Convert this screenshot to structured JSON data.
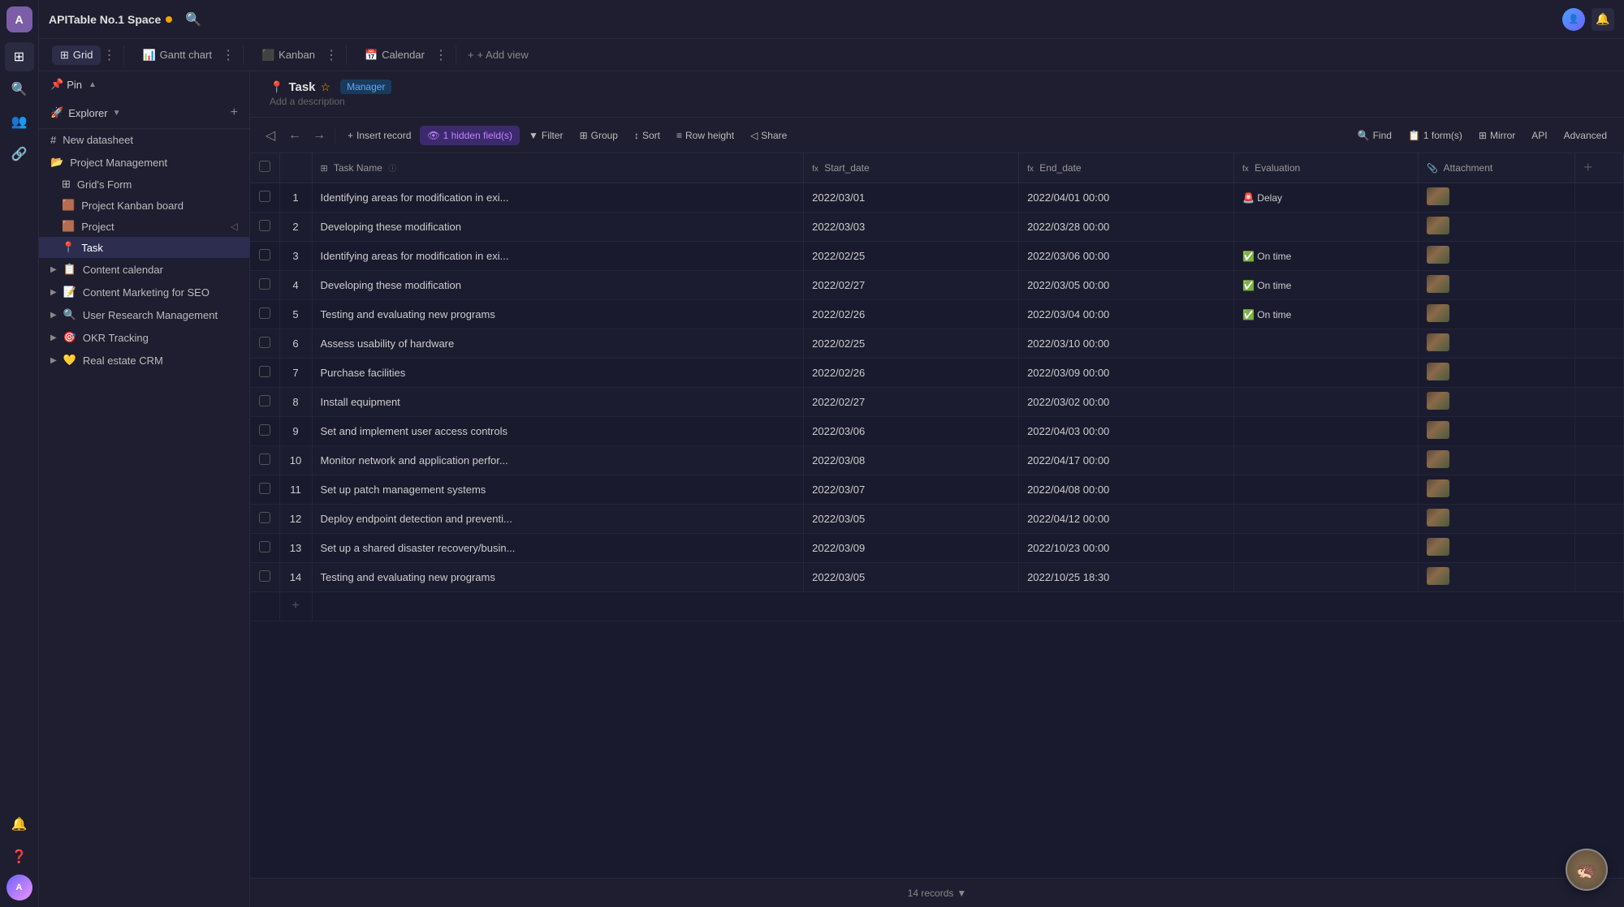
{
  "app": {
    "logo": "A",
    "workspace_title": "APITable No.1 Space",
    "search_placeholder": "Search"
  },
  "tabs": [
    {
      "id": "grid",
      "label": "Grid",
      "icon": "⊞",
      "active": true
    },
    {
      "id": "gantt",
      "label": "Gantt chart",
      "icon": "📊",
      "active": false
    },
    {
      "id": "kanban",
      "label": "Kanban",
      "icon": "⬛",
      "active": false
    },
    {
      "id": "calendar",
      "label": "Calendar",
      "icon": "📅",
      "active": false
    },
    {
      "id": "add-view",
      "label": "+ Add view",
      "active": false
    }
  ],
  "explorer": {
    "pin_label": "Pin",
    "header_label": "Explorer",
    "add_label": "+",
    "items": [
      {
        "id": "new-datasheet",
        "label": "New datasheet",
        "icon": "#",
        "indent": 0
      },
      {
        "id": "project-management",
        "label": "Project Management",
        "icon": "📁",
        "indent": 0,
        "expanded": true
      },
      {
        "id": "grids-form",
        "label": "Grid's Form",
        "icon": "⊞",
        "indent": 1
      },
      {
        "id": "project-kanban",
        "label": "Project Kanban board",
        "icon": "🟫",
        "indent": 1
      },
      {
        "id": "project",
        "label": "Project",
        "icon": "🟫",
        "indent": 1
      },
      {
        "id": "task",
        "label": "Task",
        "icon": "📍",
        "indent": 1,
        "active": true
      },
      {
        "id": "content-calendar",
        "label": "Content calendar",
        "icon": "📋",
        "indent": 0,
        "expandable": true
      },
      {
        "id": "content-marketing",
        "label": "Content Marketing for SEO",
        "icon": "📝",
        "indent": 0,
        "expandable": true
      },
      {
        "id": "user-research",
        "label": "User Research Management",
        "icon": "🔍",
        "indent": 0,
        "expandable": true
      },
      {
        "id": "okr-tracking",
        "label": "OKR Tracking",
        "icon": "🎯",
        "indent": 0,
        "expandable": true
      },
      {
        "id": "real-estate",
        "label": "Real estate CRM",
        "icon": "💛",
        "indent": 0,
        "expandable": true
      }
    ]
  },
  "toolbar": {
    "insert_record": "Insert record",
    "hidden_fields": "1 hidden field(s)",
    "filter": "Filter",
    "group": "Group",
    "sort": "Sort",
    "row_height": "Row height",
    "share": "Share",
    "find": "Find",
    "forms": "1 form(s)",
    "mirror": "Mirror",
    "api": "API",
    "advanced": "Advanced"
  },
  "table": {
    "columns": [
      {
        "id": "check",
        "label": ""
      },
      {
        "id": "num",
        "label": ""
      },
      {
        "id": "task_name",
        "label": "Task Name",
        "icon": "⊞"
      },
      {
        "id": "start_date",
        "label": "Start_date",
        "icon": "fx"
      },
      {
        "id": "end_date",
        "label": "End_date",
        "icon": "fx"
      },
      {
        "id": "evaluation",
        "label": "Evaluation",
        "icon": "fx"
      },
      {
        "id": "attachment",
        "label": "Attachment",
        "icon": "📎"
      }
    ],
    "rows": [
      {
        "num": 1,
        "task": "Identifying areas for modification in exi...",
        "start": "2022/03/01",
        "end": "2022/04/01 00:00",
        "eval": "🚨 Delay",
        "eval_type": "delay"
      },
      {
        "num": 2,
        "task": "Developing these modification",
        "start": "2022/03/03",
        "end": "2022/03/28 00:00",
        "eval": "",
        "eval_type": ""
      },
      {
        "num": 3,
        "task": "Identifying areas for modification in exi...",
        "start": "2022/02/25",
        "end": "2022/03/06 00:00",
        "eval": "✅ On time",
        "eval_type": "ontime"
      },
      {
        "num": 4,
        "task": "Developing these modification",
        "start": "2022/02/27",
        "end": "2022/03/05 00:00",
        "eval": "✅ On time",
        "eval_type": "ontime"
      },
      {
        "num": 5,
        "task": "Testing and evaluating new programs",
        "start": "2022/02/26",
        "end": "2022/03/04 00:00",
        "eval": "✅ On time",
        "eval_type": "ontime"
      },
      {
        "num": 6,
        "task": "Assess usability of hardware",
        "start": "2022/02/25",
        "end": "2022/03/10 00:00",
        "eval": "",
        "eval_type": ""
      },
      {
        "num": 7,
        "task": "Purchase facilities",
        "start": "2022/02/26",
        "end": "2022/03/09 00:00",
        "eval": "",
        "eval_type": ""
      },
      {
        "num": 8,
        "task": "Install equipment",
        "start": "2022/02/27",
        "end": "2022/03/02 00:00",
        "eval": "",
        "eval_type": ""
      },
      {
        "num": 9,
        "task": "Set and implement user access controls",
        "start": "2022/03/06",
        "end": "2022/04/03 00:00",
        "eval": "",
        "eval_type": ""
      },
      {
        "num": 10,
        "task": "Monitor network and application perfor...",
        "start": "2022/03/08",
        "end": "2022/04/17 00:00",
        "eval": "",
        "eval_type": ""
      },
      {
        "num": 11,
        "task": "Set up patch management systems",
        "start": "2022/03/07",
        "end": "2022/04/08 00:00",
        "eval": "",
        "eval_type": ""
      },
      {
        "num": 12,
        "task": "Deploy endpoint detection and preventi...",
        "start": "2022/03/05",
        "end": "2022/04/12 00:00",
        "eval": "",
        "eval_type": ""
      },
      {
        "num": 13,
        "task": "Set up a shared disaster recovery/busin...",
        "start": "2022/03/09",
        "end": "2022/10/23 00:00",
        "eval": "",
        "eval_type": ""
      },
      {
        "num": 14,
        "task": "Testing and evaluating new programs",
        "start": "2022/03/05",
        "end": "2022/10/25 18:30",
        "eval": "",
        "eval_type": ""
      }
    ],
    "record_count": "14 records"
  },
  "task_header": {
    "title": "Task",
    "tag": "Manager",
    "description": "Add a description",
    "star": "☆"
  }
}
